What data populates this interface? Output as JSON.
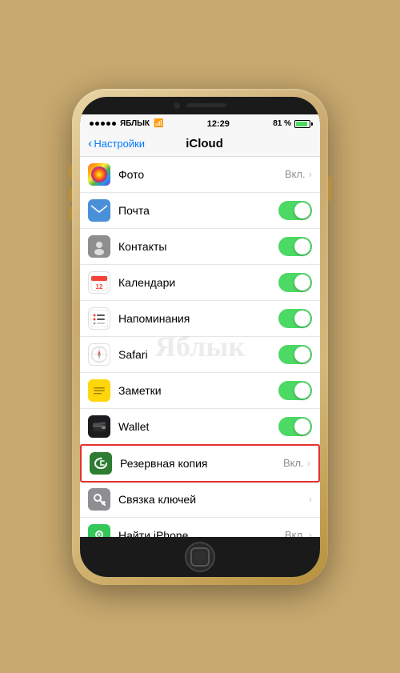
{
  "statusBar": {
    "carrier": "ЯБЛЫК",
    "time": "12:29",
    "battery": "81 %",
    "signal": 5
  },
  "navBar": {
    "backLabel": "Настройки",
    "title": "iCloud"
  },
  "watermark": "Яблык",
  "rows": [
    {
      "id": "photos",
      "label": "Фото",
      "valueText": "Вкл.",
      "hasChevron": true,
      "hasToggle": false,
      "iconType": "photos",
      "highlighted": false
    },
    {
      "id": "mail",
      "label": "Почта",
      "valueText": "",
      "hasChevron": false,
      "hasToggle": true,
      "toggleOn": true,
      "iconType": "mail",
      "highlighted": false
    },
    {
      "id": "contacts",
      "label": "Контакты",
      "valueText": "",
      "hasChevron": false,
      "hasToggle": true,
      "toggleOn": true,
      "iconType": "contacts",
      "highlighted": false
    },
    {
      "id": "calendar",
      "label": "Календари",
      "valueText": "",
      "hasChevron": false,
      "hasToggle": true,
      "toggleOn": true,
      "iconType": "calendar",
      "highlighted": false
    },
    {
      "id": "reminders",
      "label": "Напоминания",
      "valueText": "",
      "hasChevron": false,
      "hasToggle": true,
      "toggleOn": true,
      "iconType": "reminders",
      "highlighted": false
    },
    {
      "id": "safari",
      "label": "Safari",
      "valueText": "",
      "hasChevron": false,
      "hasToggle": true,
      "toggleOn": true,
      "iconType": "safari",
      "highlighted": false
    },
    {
      "id": "notes",
      "label": "Заметки",
      "valueText": "",
      "hasChevron": false,
      "hasToggle": true,
      "toggleOn": true,
      "iconType": "notes",
      "highlighted": false
    },
    {
      "id": "wallet",
      "label": "Wallet",
      "valueText": "",
      "hasChevron": false,
      "hasToggle": true,
      "toggleOn": true,
      "iconType": "wallet",
      "highlighted": false
    },
    {
      "id": "backup",
      "label": "Резервная копия",
      "valueText": "Вкл.",
      "hasChevron": true,
      "hasToggle": false,
      "iconType": "backup",
      "highlighted": true
    },
    {
      "id": "keychain",
      "label": "Связка ключей",
      "valueText": "",
      "hasChevron": true,
      "hasToggle": false,
      "iconType": "keychain",
      "highlighted": false
    },
    {
      "id": "findiphone",
      "label": "Найти iPhone",
      "valueText": "Вкл.",
      "hasChevron": true,
      "hasToggle": false,
      "iconType": "findiphone",
      "highlighted": false
    }
  ]
}
